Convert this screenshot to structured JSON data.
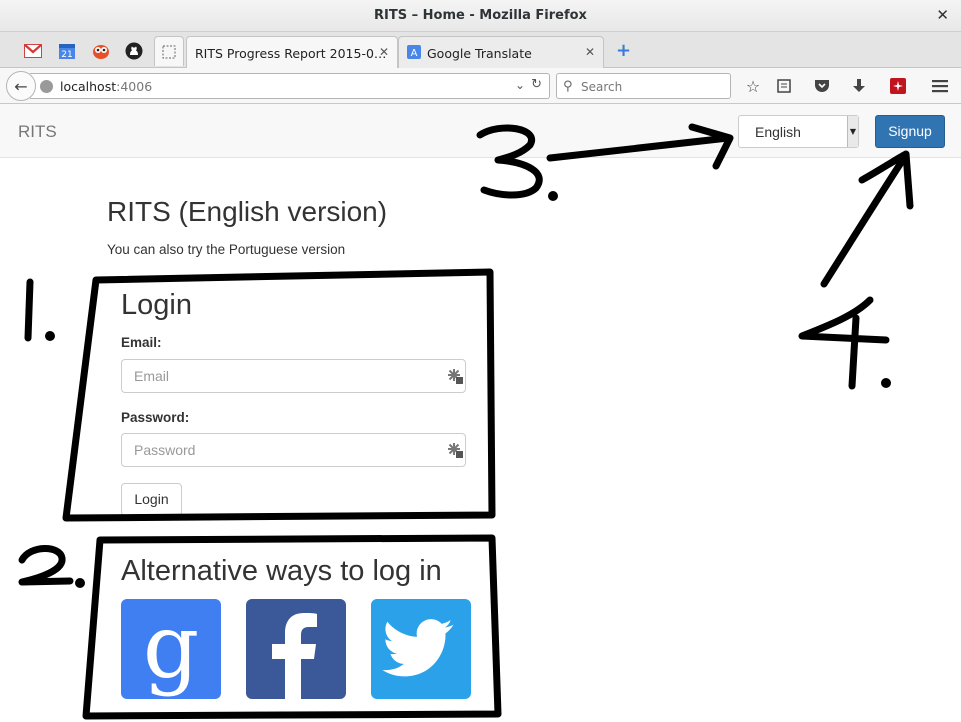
{
  "window": {
    "title": "RITS – Home - Mozilla Firefox",
    "close_glyph": "✕"
  },
  "tabs": [
    {
      "label": "RITS Progress Report 2015-0…",
      "close": "✕"
    },
    {
      "label": "Google Translate",
      "close": "✕"
    }
  ],
  "pinned_tabs": [
    "gmail-icon",
    "calendar-icon",
    "owl-icon",
    "github-icon",
    "blank-tab-icon"
  ],
  "calendar_day": "21",
  "new_tab": "+",
  "navbar": {
    "url_host": "localhost",
    "url_port": ":4006",
    "search_placeholder": "Search"
  },
  "app": {
    "brand": "RITS",
    "language": "English",
    "signup_label": "Signup",
    "title": "RITS (English version)",
    "alt_version_text": "You can also try the Portuguese version",
    "login_heading": "Login",
    "email_label": "Email:",
    "email_placeholder": "Email",
    "password_label": "Password:",
    "password_placeholder": "Password",
    "login_button": "Login",
    "alt_heading": "Alternative ways to log in",
    "social": [
      "google-login",
      "facebook-login",
      "twitter-login"
    ]
  },
  "annotations": {
    "numbers": [
      "1.",
      "2.",
      "3.",
      "4."
    ],
    "color": "#000000"
  },
  "colors": {
    "signup": "#3174b2",
    "google": "#3f7ff1",
    "facebook": "#3b5998",
    "twitter": "#2ba1ea"
  }
}
